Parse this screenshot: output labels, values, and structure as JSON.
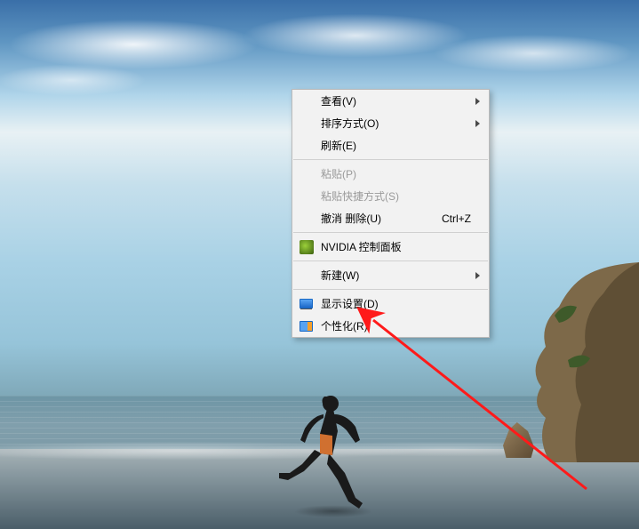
{
  "menu": {
    "view": {
      "label": "查看(V)"
    },
    "sort": {
      "label": "排序方式(O)"
    },
    "refresh": {
      "label": "刷新(E)"
    },
    "paste": {
      "label": "粘贴(P)"
    },
    "pasteShortcut": {
      "label": "粘贴快捷方式(S)"
    },
    "undo": {
      "label": "撤消 删除(U)",
      "shortcut": "Ctrl+Z"
    },
    "nvidia": {
      "label": "NVIDIA 控制面板"
    },
    "new": {
      "label": "新建(W)"
    },
    "display": {
      "label": "显示设置(D)"
    },
    "personalize": {
      "label": "个性化(R)"
    }
  }
}
